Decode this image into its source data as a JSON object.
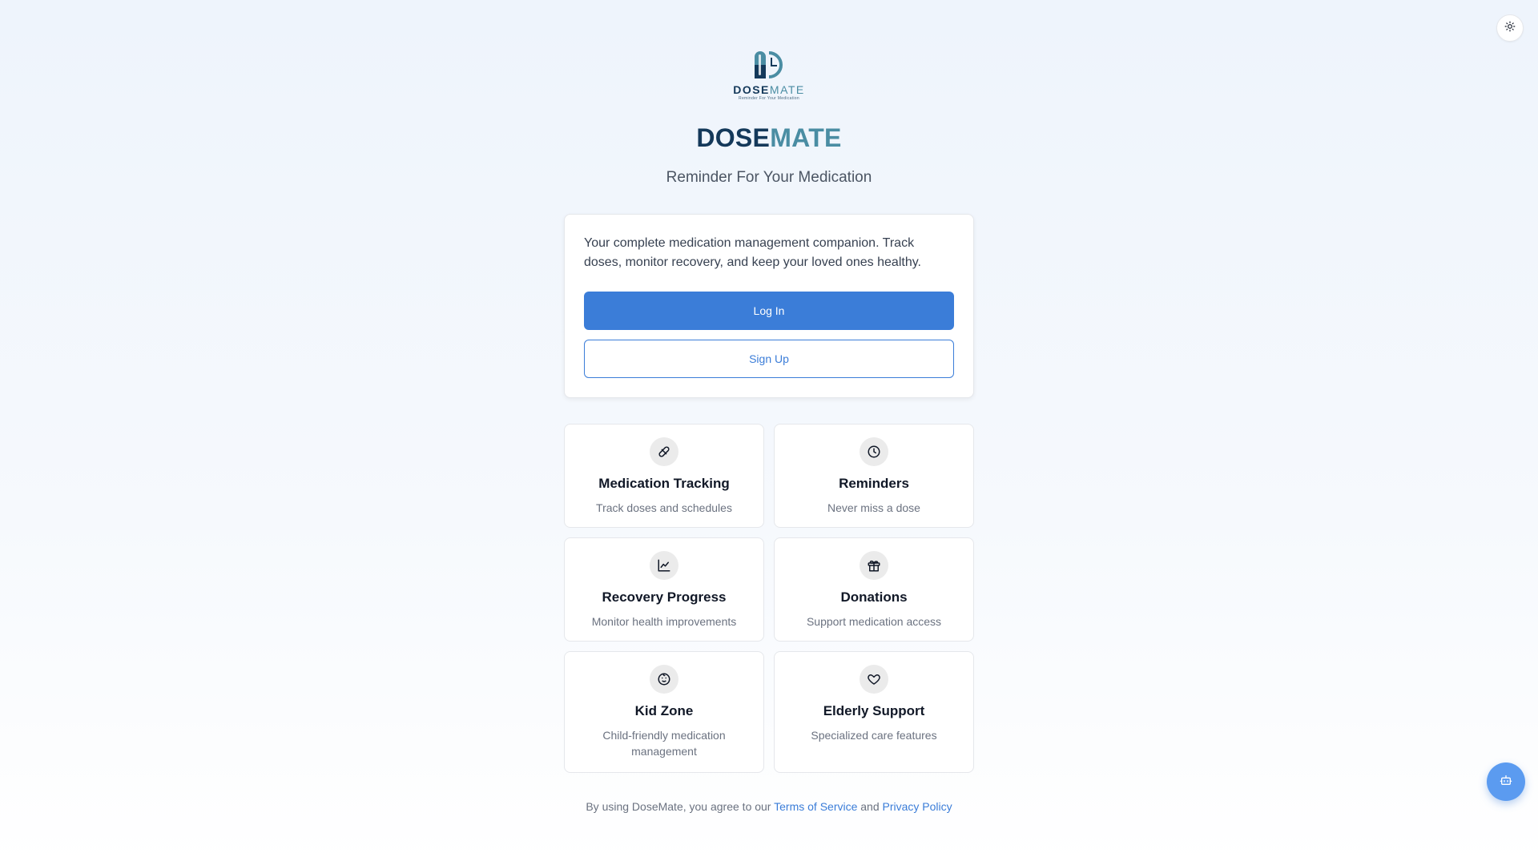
{
  "brand": {
    "logo_word_a": "DOSE",
    "logo_word_b": "MATE",
    "logo_tagline": "Reminder For Your Medication",
    "title_a": "DOSE",
    "title_b": "MATE",
    "tagline": "Reminder For Your Medication"
  },
  "card": {
    "description": "Your complete medication management companion. Track doses, monitor recovery, and keep your loved ones healthy.",
    "login_label": "Log In",
    "signup_label": "Sign Up"
  },
  "features": [
    {
      "title": "Medication Tracking",
      "desc": "Track doses and schedules",
      "icon": "pill-icon"
    },
    {
      "title": "Reminders",
      "desc": "Never miss a dose",
      "icon": "clock-icon"
    },
    {
      "title": "Recovery Progress",
      "desc": "Monitor health improvements",
      "icon": "chart-line-icon"
    },
    {
      "title": "Donations",
      "desc": "Support medication access",
      "icon": "gift-icon"
    },
    {
      "title": "Kid Zone",
      "desc": "Child-friendly medication management",
      "icon": "baby-icon"
    },
    {
      "title": "Elderly Support",
      "desc": "Specialized care features",
      "icon": "heart-icon"
    }
  ],
  "footer": {
    "prefix": "By using DoseMate, you agree to our",
    "terms": "Terms of Service",
    "and": "and",
    "privacy": "Privacy Policy"
  },
  "colors": {
    "primary": "#3b7dd8",
    "brand_dark": "#14395a",
    "brand_light": "#4a8da3"
  },
  "icons": {
    "theme_toggle": "sun-icon",
    "chat": "bot-icon"
  }
}
